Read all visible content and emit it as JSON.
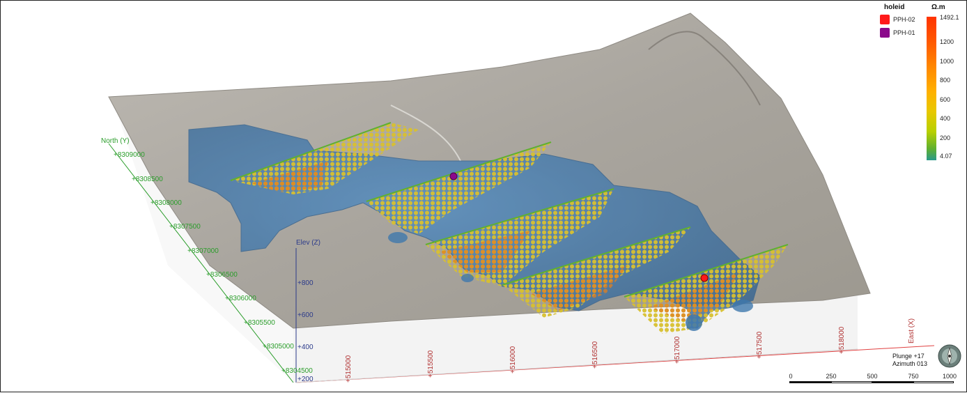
{
  "legend_holeid": {
    "title": "holeid",
    "items": [
      {
        "label": "PPH-02",
        "color": "#ff1a1a"
      },
      {
        "label": "PPH-01",
        "color": "#8b0a8b"
      }
    ]
  },
  "legend_scale": {
    "unit": "Ω.m",
    "labels": [
      "1492.1",
      "1200",
      "1000",
      "800",
      "600",
      "400",
      "200",
      "4.07"
    ]
  },
  "axes": {
    "north_title": "North (Y)",
    "north_ticks": [
      "+8309000",
      "+8308500",
      "+8308000",
      "+8307500",
      "+8307000",
      "+8306500",
      "+8306000",
      "+8305500",
      "+8305000",
      "+8304500"
    ],
    "east_title": "East (X)",
    "east_ticks": [
      "+515000",
      "+515500",
      "+516000",
      "+516500",
      "+517000",
      "+517500",
      "+518000"
    ],
    "elev_title": "Elev (Z)",
    "elev_ticks": [
      "+800",
      "+600",
      "+400",
      "+200"
    ]
  },
  "orientation": {
    "plunge": "Plunge +17",
    "azimuth": "Azimuth 013"
  },
  "scale_bar": {
    "labels": [
      "0",
      "250",
      "500",
      "750",
      "1000"
    ]
  },
  "colors": {
    "terrain": "#a8a49c",
    "body": "#3f78ad",
    "north_axis": "#2a9d2a",
    "east_axis": "#b03030",
    "elev_axis": "#2b3a8a"
  }
}
